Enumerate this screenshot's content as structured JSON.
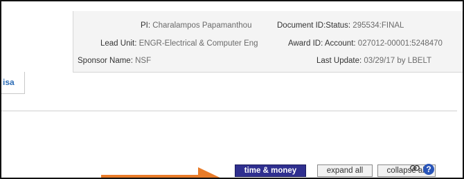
{
  "award_header": {
    "pi_label": "PI: ",
    "pi_value": "Charalampos Papamanthou",
    "document_label": "Document ID:Status: ",
    "document_value": "295534:FINAL",
    "lead_unit_label": "Lead Unit: ",
    "lead_unit_value": "ENGR-Electrical & Computer Eng",
    "award_label": "Award ID: Account: ",
    "award_value": "027012-00001:5248470",
    "sponsor_label": "Sponsor Name: ",
    "sponsor_value": "NSF",
    "last_update_label": "Last Update: ",
    "last_update_value": "03/29/17 by LBELT"
  },
  "tabs": [
    {
      "label": "isa",
      "active": true
    }
  ],
  "toolbar": {
    "time_money_label": "time & money",
    "expand_all_label": "expand all",
    "collapse_all_label": "collapse all",
    "link_icon": "link-icon",
    "help_icon": "help-icon",
    "help_glyph": "?"
  },
  "annotation": {
    "arrow_color": "#e87c2a"
  }
}
